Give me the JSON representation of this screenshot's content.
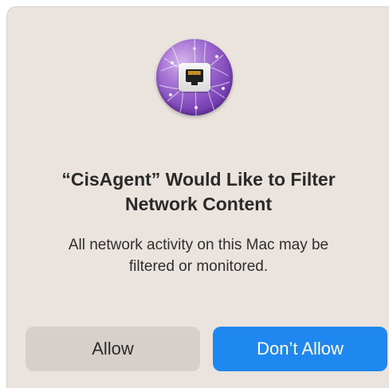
{
  "dialog": {
    "app_icon": "network-filter-icon",
    "title_line1": "“CisAgent” Would Like to Filter",
    "title_line2": "Network Content",
    "message_line1": "All network activity on this Mac may be",
    "message_line2": "filtered or monitored.",
    "allow_label": "Allow",
    "dont_allow_label": "Don’t Allow"
  },
  "colors": {
    "dialog_background": "#eae3de",
    "default_button": "#1f88f0",
    "secondary_button": "#d6cfca"
  }
}
